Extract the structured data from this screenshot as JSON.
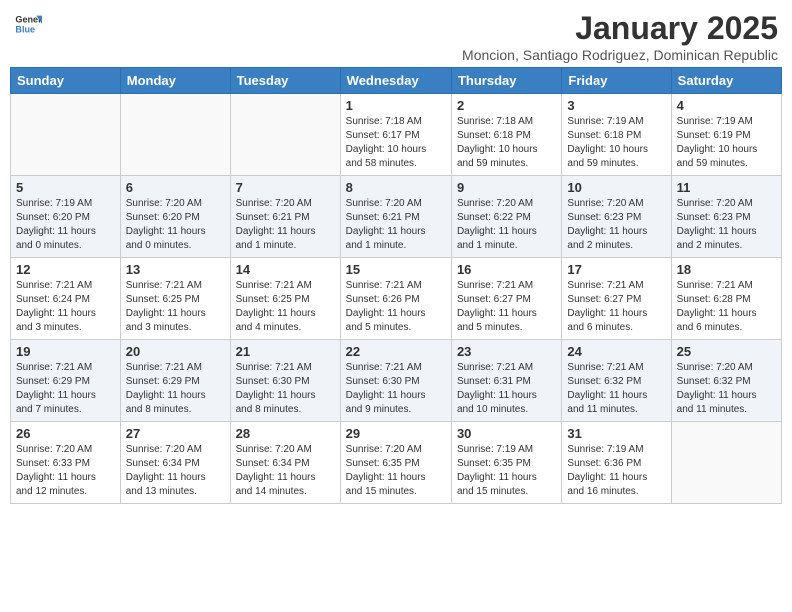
{
  "header": {
    "logo_general": "General",
    "logo_blue": "Blue",
    "month_title": "January 2025",
    "subtitle": "Moncion, Santiago Rodriguez, Dominican Republic"
  },
  "days_of_week": [
    "Sunday",
    "Monday",
    "Tuesday",
    "Wednesday",
    "Thursday",
    "Friday",
    "Saturday"
  ],
  "weeks": [
    [
      {
        "day": "",
        "info": ""
      },
      {
        "day": "",
        "info": ""
      },
      {
        "day": "",
        "info": ""
      },
      {
        "day": "1",
        "info": "Sunrise: 7:18 AM\nSunset: 6:17 PM\nDaylight: 10 hours\nand 58 minutes."
      },
      {
        "day": "2",
        "info": "Sunrise: 7:18 AM\nSunset: 6:18 PM\nDaylight: 10 hours\nand 59 minutes."
      },
      {
        "day": "3",
        "info": "Sunrise: 7:19 AM\nSunset: 6:18 PM\nDaylight: 10 hours\nand 59 minutes."
      },
      {
        "day": "4",
        "info": "Sunrise: 7:19 AM\nSunset: 6:19 PM\nDaylight: 10 hours\nand 59 minutes."
      }
    ],
    [
      {
        "day": "5",
        "info": "Sunrise: 7:19 AM\nSunset: 6:20 PM\nDaylight: 11 hours\nand 0 minutes."
      },
      {
        "day": "6",
        "info": "Sunrise: 7:20 AM\nSunset: 6:20 PM\nDaylight: 11 hours\nand 0 minutes."
      },
      {
        "day": "7",
        "info": "Sunrise: 7:20 AM\nSunset: 6:21 PM\nDaylight: 11 hours\nand 1 minute."
      },
      {
        "day": "8",
        "info": "Sunrise: 7:20 AM\nSunset: 6:21 PM\nDaylight: 11 hours\nand 1 minute."
      },
      {
        "day": "9",
        "info": "Sunrise: 7:20 AM\nSunset: 6:22 PM\nDaylight: 11 hours\nand 1 minute."
      },
      {
        "day": "10",
        "info": "Sunrise: 7:20 AM\nSunset: 6:23 PM\nDaylight: 11 hours\nand 2 minutes."
      },
      {
        "day": "11",
        "info": "Sunrise: 7:20 AM\nSunset: 6:23 PM\nDaylight: 11 hours\nand 2 minutes."
      }
    ],
    [
      {
        "day": "12",
        "info": "Sunrise: 7:21 AM\nSunset: 6:24 PM\nDaylight: 11 hours\nand 3 minutes."
      },
      {
        "day": "13",
        "info": "Sunrise: 7:21 AM\nSunset: 6:25 PM\nDaylight: 11 hours\nand 3 minutes."
      },
      {
        "day": "14",
        "info": "Sunrise: 7:21 AM\nSunset: 6:25 PM\nDaylight: 11 hours\nand 4 minutes."
      },
      {
        "day": "15",
        "info": "Sunrise: 7:21 AM\nSunset: 6:26 PM\nDaylight: 11 hours\nand 5 minutes."
      },
      {
        "day": "16",
        "info": "Sunrise: 7:21 AM\nSunset: 6:27 PM\nDaylight: 11 hours\nand 5 minutes."
      },
      {
        "day": "17",
        "info": "Sunrise: 7:21 AM\nSunset: 6:27 PM\nDaylight: 11 hours\nand 6 minutes."
      },
      {
        "day": "18",
        "info": "Sunrise: 7:21 AM\nSunset: 6:28 PM\nDaylight: 11 hours\nand 6 minutes."
      }
    ],
    [
      {
        "day": "19",
        "info": "Sunrise: 7:21 AM\nSunset: 6:29 PM\nDaylight: 11 hours\nand 7 minutes."
      },
      {
        "day": "20",
        "info": "Sunrise: 7:21 AM\nSunset: 6:29 PM\nDaylight: 11 hours\nand 8 minutes."
      },
      {
        "day": "21",
        "info": "Sunrise: 7:21 AM\nSunset: 6:30 PM\nDaylight: 11 hours\nand 8 minutes."
      },
      {
        "day": "22",
        "info": "Sunrise: 7:21 AM\nSunset: 6:30 PM\nDaylight: 11 hours\nand 9 minutes."
      },
      {
        "day": "23",
        "info": "Sunrise: 7:21 AM\nSunset: 6:31 PM\nDaylight: 11 hours\nand 10 minutes."
      },
      {
        "day": "24",
        "info": "Sunrise: 7:21 AM\nSunset: 6:32 PM\nDaylight: 11 hours\nand 11 minutes."
      },
      {
        "day": "25",
        "info": "Sunrise: 7:20 AM\nSunset: 6:32 PM\nDaylight: 11 hours\nand 11 minutes."
      }
    ],
    [
      {
        "day": "26",
        "info": "Sunrise: 7:20 AM\nSunset: 6:33 PM\nDaylight: 11 hours\nand 12 minutes."
      },
      {
        "day": "27",
        "info": "Sunrise: 7:20 AM\nSunset: 6:34 PM\nDaylight: 11 hours\nand 13 minutes."
      },
      {
        "day": "28",
        "info": "Sunrise: 7:20 AM\nSunset: 6:34 PM\nDaylight: 11 hours\nand 14 minutes."
      },
      {
        "day": "29",
        "info": "Sunrise: 7:20 AM\nSunset: 6:35 PM\nDaylight: 11 hours\nand 15 minutes."
      },
      {
        "day": "30",
        "info": "Sunrise: 7:19 AM\nSunset: 6:35 PM\nDaylight: 11 hours\nand 15 minutes."
      },
      {
        "day": "31",
        "info": "Sunrise: 7:19 AM\nSunset: 6:36 PM\nDaylight: 11 hours\nand 16 minutes."
      },
      {
        "day": "",
        "info": ""
      }
    ]
  ]
}
